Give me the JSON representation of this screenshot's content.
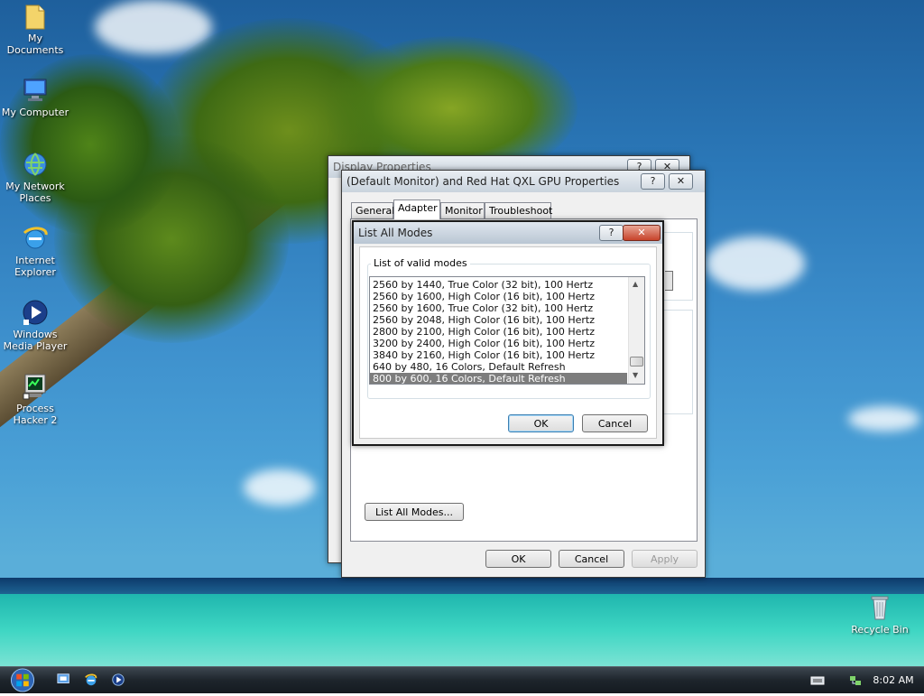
{
  "desktop_icons": [
    {
      "label": "My Documents",
      "icon": "folder-icon"
    },
    {
      "label": "My Computer",
      "icon": "computer-icon"
    },
    {
      "label": "My Network Places",
      "icon": "network-globe-icon"
    },
    {
      "label": "Internet Explorer",
      "icon": "internet-explorer-icon"
    },
    {
      "label": "Windows Media Player",
      "icon": "media-player-icon"
    },
    {
      "label": "Process Hacker 2",
      "icon": "process-hacker-icon"
    },
    {
      "label": "Recycle Bin",
      "icon": "recycle-bin-icon"
    }
  ],
  "display_properties": {
    "title": "Display Properties",
    "help": "?",
    "close": "✕"
  },
  "gpu_properties": {
    "title": "(Default Monitor) and Red Hat QXL GPU Properties",
    "help": "?",
    "close": "✕",
    "tabs": [
      "General",
      "Adapter",
      "Monitor",
      "Troubleshoot"
    ],
    "active_tab": "Adapter",
    "list_all_modes_button": "List All Modes...",
    "ok": "OK",
    "cancel": "Cancel",
    "apply": "Apply"
  },
  "list_all_modes": {
    "title": "List All Modes",
    "help": "?",
    "close": "✕",
    "group_label": "List of valid modes",
    "modes": [
      "2560 by 1440, True Color (32 bit), 100 Hertz",
      "2560 by 1600, High Color (16 bit), 100 Hertz",
      "2560 by 1600, True Color (32 bit), 100 Hertz",
      "2560 by 2048, High Color (16 bit), 100 Hertz",
      "2800 by 2100, High Color (16 bit), 100 Hertz",
      "3200 by 2400, High Color (16 bit), 100 Hertz",
      "3840 by 2160, High Color (16 bit), 100 Hertz",
      "640 by 480, 16 Colors, Default Refresh",
      "800 by 600, 16 Colors, Default Refresh"
    ],
    "selected_mode": "800 by 600, 16 Colors, Default Refresh",
    "ok": "OK",
    "cancel": "Cancel"
  },
  "taskbar": {
    "quick_launch": [
      "start-orb-icon",
      "show-desktop-icon",
      "internet-explorer-icon",
      "media-player-icon"
    ],
    "tray_icons": [
      "keyboard-icon",
      "network-tray-icon"
    ],
    "clock": "8:02 AM"
  }
}
